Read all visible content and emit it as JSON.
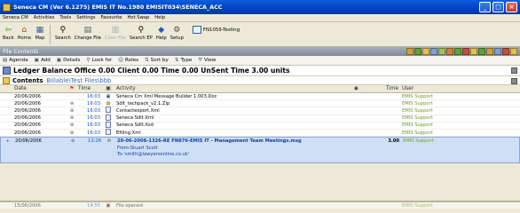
{
  "window": {
    "title": "Seneca CM (Ver 6.1275) EMIS IT No.1980 EMISIT034\\SENECA_ACC"
  },
  "menu": [
    "Seneca CM",
    "Activities",
    "Tools",
    "Settings",
    "Favourite",
    "Hot Swap",
    "Help"
  ],
  "toolbar": {
    "items": [
      {
        "label": "Back",
        "icon": "back-arrow-icon"
      },
      {
        "label": "Home",
        "icon": "home-icon"
      },
      {
        "label": "Map",
        "icon": "map-icon"
      },
      {
        "label": "Search",
        "icon": "search-icon"
      },
      {
        "label": "Change File",
        "icon": "change-file-icon"
      },
      {
        "label": "Clear File",
        "icon": "clear-file-icon",
        "disabled": true
      },
      {
        "label": "Search EP",
        "icon": "search-ep-icon"
      },
      {
        "label": "Help",
        "icon": "help-icon"
      },
      {
        "label": "Setup",
        "icon": "setup-icon"
      }
    ],
    "profile": "FN1059-Testing"
  },
  "section": {
    "title": "File Contents"
  },
  "actions": [
    "Agenda",
    "Add",
    "Details",
    "Look for",
    "Roles",
    "Sort by",
    "Type",
    "View"
  ],
  "ledger": {
    "text": "Ledger Balance Office 0.00 Client 0.00 Time 0.00 UnSent Time 3.00 units"
  },
  "contents": {
    "label": "Contents",
    "path": "Billable\\Test Files\\bbb"
  },
  "columns": {
    "date": "Date",
    "time": "Time",
    "activity": "Activity",
    "time2": "Time",
    "user": "User"
  },
  "rows": [
    {
      "date": "20/06/2006",
      "time": "16:03",
      "activity": "Seneca Cm Xml Message Builder 1.003.Doc",
      "user": "EMIS Support"
    },
    {
      "date": "20/06/2006",
      "time": "16:03",
      "activity": "Sdlt_techpack_v2.1.Zip",
      "user": "EMIS Support"
    },
    {
      "date": "20/06/2006",
      "time": "16:03",
      "activity": "Contactexport.Xml",
      "user": "EMIS Support"
    },
    {
      "date": "20/06/2006",
      "time": "16:03",
      "activity": "Seneca Sdlt.Xml",
      "user": "EMIS Support"
    },
    {
      "date": "20/06/2006",
      "time": "16:03",
      "activity": "Seneca Sdlt.Xsd",
      "user": "EMIS Support"
    },
    {
      "date": "20/06/2006",
      "time": "16:03",
      "activity": "Efiling.Xml",
      "user": "EMIS Support"
    }
  ],
  "selected": {
    "date": "20/06/2006",
    "time": "13:26",
    "line1": "20-06-2006-1326-RE FN876-EMIS IT - Management Team Meetings.msg",
    "line2": "From-Stuart Scott",
    "line3": "To-'smith@lawyersonline.co.uk'",
    "units": "3.00",
    "user": "EMIS Support"
  },
  "partial": {
    "date": "15/06/2006",
    "time": "14:55",
    "activity": "File opened",
    "user": "EMIS Support"
  }
}
